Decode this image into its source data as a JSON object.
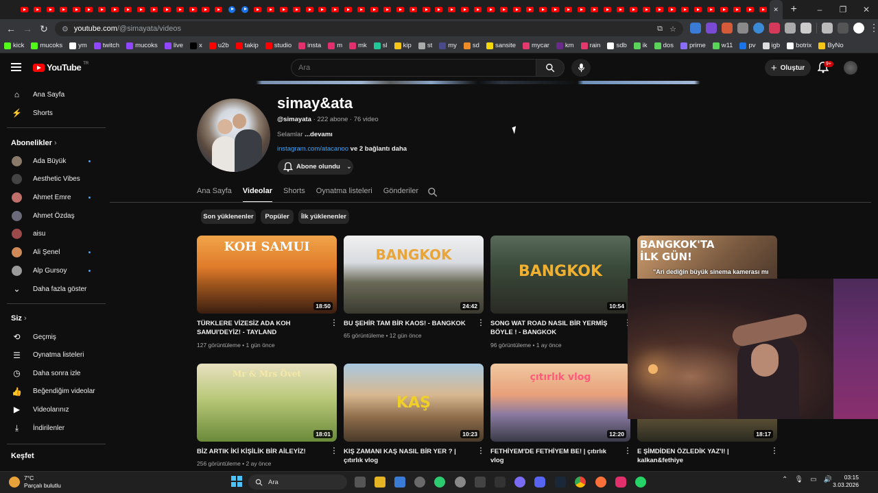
{
  "browser": {
    "url_host": "youtube.com",
    "url_path": "/@simayata/videos",
    "bookmarks": [
      {
        "label": "kick",
        "color": "#53fc18"
      },
      {
        "label": "mucoks",
        "color": "#53fc18"
      },
      {
        "label": "ym",
        "color": "#ffffff"
      },
      {
        "label": "twitch",
        "color": "#9146ff"
      },
      {
        "label": "mucoks",
        "color": "#9146ff"
      },
      {
        "label": "live",
        "color": "#9146ff"
      },
      {
        "label": "x",
        "color": "#000000"
      },
      {
        "label": "u2b",
        "color": "#ff0000"
      },
      {
        "label": "takip",
        "color": "#ff0000"
      },
      {
        "label": "studio",
        "color": "#ff0000"
      },
      {
        "label": "insta",
        "color": "#e1306c"
      },
      {
        "label": "m",
        "color": "#e1306c"
      },
      {
        "label": "mk",
        "color": "#e1306c"
      },
      {
        "label": "sl",
        "color": "#20c997"
      },
      {
        "label": "kip",
        "color": "#f5c518"
      },
      {
        "label": "st",
        "color": "#aaaaaa"
      },
      {
        "label": "my",
        "color": "#4a4a8a"
      },
      {
        "label": "sd",
        "color": "#f08c28"
      },
      {
        "label": "sansite",
        "color": "#f5d90a"
      },
      {
        "label": "mycar",
        "color": "#e5386d"
      },
      {
        "label": "km",
        "color": "#6a2a8a"
      },
      {
        "label": "rain",
        "color": "#e5386d"
      },
      {
        "label": "sdb",
        "color": "#ffffff"
      },
      {
        "label": "ik",
        "color": "#5bd35b"
      },
      {
        "label": "dos",
        "color": "#5bd35b"
      },
      {
        "label": "prime",
        "color": "#8a6df5"
      },
      {
        "label": "w11",
        "color": "#5bd35b"
      },
      {
        "label": "pv",
        "color": "#1a73e8"
      },
      {
        "label": "igb",
        "color": "#dddddd"
      },
      {
        "label": "botrix",
        "color": "#ffffff"
      },
      {
        "label": "ByNo",
        "color": "#f5c518"
      }
    ]
  },
  "header": {
    "logo_text": "YouTube",
    "logo_region": "TR",
    "search_placeholder": "Ara",
    "create_label": "Oluştur",
    "notif_count": "9+"
  },
  "sidebar": {
    "home": "Ana Sayfa",
    "shorts": "Shorts",
    "subs_heading": "Abonelikler",
    "subscriptions": [
      {
        "name": "Ada Büyük",
        "dot": true,
        "color": "#8a7a6a"
      },
      {
        "name": "Aesthetic Vibes",
        "dot": false,
        "color": "#444444"
      },
      {
        "name": "Ahmet Emre",
        "dot": true,
        "color": "#c0706a"
      },
      {
        "name": "Ahmet Özdaş",
        "dot": false,
        "color": "#6a6a7a"
      },
      {
        "name": "aisu",
        "dot": false,
        "color": "#9a4a4a"
      },
      {
        "name": "Ali Şenel",
        "dot": true,
        "color": "#d08a5a"
      },
      {
        "name": "Alp Gursoy",
        "dot": true,
        "color": "#9a9a9a"
      }
    ],
    "show_more": "Daha fazla göster",
    "you_heading": "Siz",
    "you_items": [
      "Geçmiş",
      "Oynatma listeleri",
      "Daha sonra izle",
      "Beğendiğim videolar",
      "Videolarınız",
      "İndirilenler"
    ],
    "explore_heading": "Keşfet"
  },
  "channel": {
    "name": "simay&ata",
    "handle": "@simayata",
    "stats": " · 222 abone · 76 video",
    "desc": "Selamlar ",
    "desc_more": "...devamı",
    "link": "instagram.com/atacanoo",
    "link_more": " ve 2 bağlantı daha",
    "subscribed_label": "Abone olundu",
    "tabs": [
      "Ana Sayfa",
      "Videolar",
      "Shorts",
      "Oynatma listeleri",
      "Gönderiler"
    ],
    "active_tab": "Videolar",
    "chips": [
      "Son yüklenenler",
      "Popüler",
      "İlk yüklenenler"
    ]
  },
  "videos": [
    {
      "thumb_text": "KOH SAMUI",
      "duration": "18:50",
      "title": "TÜRKLERE VİZESİZ ADA KOH SAMUI'DEYİZ! - TAYLAND",
      "views": "127 görüntüleme",
      "age": "1 gün önce"
    },
    {
      "thumb_text": "BANGKOK",
      "duration": "24:42",
      "title": "BU ŞEHİR TAM BİR KAOS! - BANGKOK",
      "views": "65 görüntüleme",
      "age": "12 gün önce"
    },
    {
      "thumb_text": "BANGKOK",
      "duration": "10:54",
      "title": "SONG WAT ROAD NASIL BİR YERMİŞ BÖYLE ! - BANGKOK",
      "views": "96 görüntüleme",
      "age": "1 ay önce"
    },
    {
      "thumb_text": "BANGKOK'TA İLK GÜN!",
      "duration": "",
      "title": "",
      "views": "",
      "age": ""
    },
    {
      "thumb_text": "Mr & Mrs Övet",
      "duration": "18:01",
      "title": "BİZ ARTIK İKİ KİŞİLİK BİR AİLEYİZ!",
      "views": "256 görüntüleme",
      "age": "2 ay önce"
    },
    {
      "thumb_text": "KAŞ",
      "duration": "10:23",
      "title": "KIŞ ZAMANI KAŞ NASIL BİR YER ? | çıtırlık vlog",
      "views": "",
      "age": ""
    },
    {
      "thumb_text": "çıtırlık vlog",
      "duration": "12:20",
      "title": "FETHİYEM'DE FETHİYEM BE! | çıtırlık vlog",
      "views": "158 görüntüleme",
      "age": "3 ay önce"
    },
    {
      "thumb_text": "",
      "duration": "18:17",
      "title": "E ŞİMDİDEN ÖZLEDİK YAZ'I! | kalkan&fethiye",
      "views": "249 görüntüleme",
      "age": "4 ay önce"
    }
  ],
  "overlay_caption": "\"Ari dediğin büyük sinema kamerası mı",
  "taskbar": {
    "temp": "7°C",
    "weather": "Parçalı bulutlu",
    "search": "Ara",
    "time": "03:15",
    "date": "3.03.2026"
  }
}
